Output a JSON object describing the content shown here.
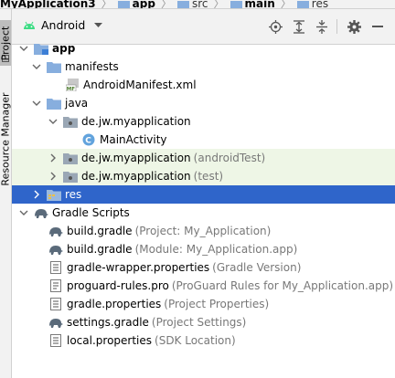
{
  "breadcrumb": {
    "items": [
      "MyApplication3",
      "app",
      "src",
      "main",
      "res"
    ]
  },
  "side_tabs": {
    "project": "Project",
    "resource_manager": "Resource Manager"
  },
  "toolbar": {
    "view_label": "Android"
  },
  "tree": {
    "app": "app",
    "manifests": "manifests",
    "android_manifest": "AndroidManifest.xml",
    "java": "java",
    "pkg_main": "de.jw.myapplication",
    "main_activity": "MainActivity",
    "pkg_android_test": "de.jw.myapplication",
    "pkg_android_test_hint": "(androidTest)",
    "pkg_test": "de.jw.myapplication",
    "pkg_test_hint": "(test)",
    "res": "res",
    "gradle_scripts": "Gradle Scripts",
    "files": [
      {
        "name": "build.gradle",
        "hint": "(Project: My_Application)"
      },
      {
        "name": "build.gradle",
        "hint": "(Module: My_Application.app)"
      },
      {
        "name": "gradle-wrapper.properties",
        "hint": "(Gradle Version)"
      },
      {
        "name": "proguard-rules.pro",
        "hint": "(ProGuard Rules for My_Application.app)"
      },
      {
        "name": "gradle.properties",
        "hint": "(Project Properties)"
      },
      {
        "name": "settings.gradle",
        "hint": "(Project Settings)"
      },
      {
        "name": "local.properties",
        "hint": "(SDK Location)"
      }
    ]
  },
  "colors": {
    "selection": "#2f65ca",
    "test_row": "#eef6e6",
    "folder": "#87aede",
    "android_green": "#3ddc84"
  }
}
